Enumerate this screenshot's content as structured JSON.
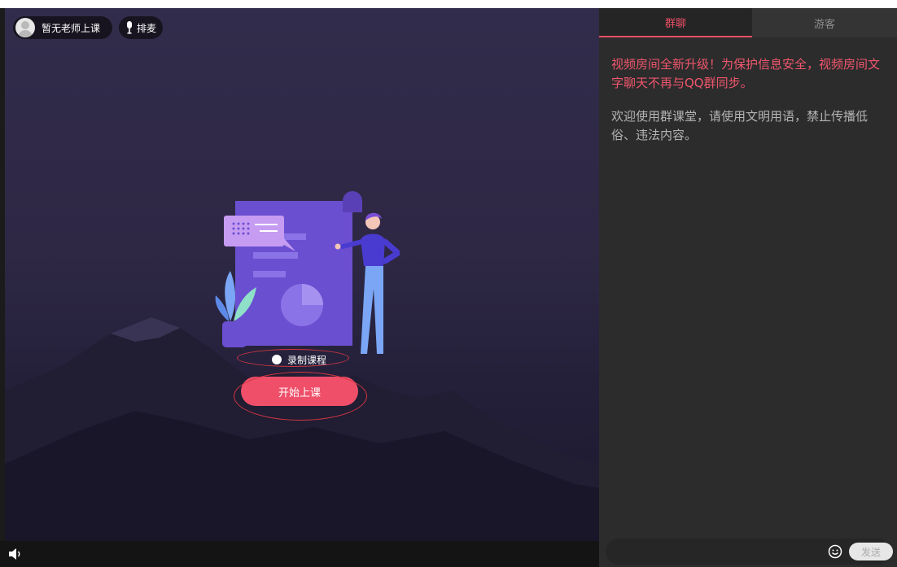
{
  "stage": {
    "teacher_label": "暂无老师上课",
    "queue_label": "排麦",
    "record_label": "录制课程",
    "start_button": "开始上课"
  },
  "chat_panel": {
    "tabs": [
      {
        "label": "群聊",
        "active": true
      },
      {
        "label": "游客",
        "active": false
      }
    ],
    "messages": [
      {
        "text": "视频房间全新升级！为保护信息安全，视频房间文字聊天不再与QQ群同步。",
        "color": "#f0566d"
      },
      {
        "text": "欢迎使用群课堂，请使用文明用语，禁止传播低俗、违法内容。",
        "color": "#b4b4b4"
      }
    ],
    "input_value": "",
    "send_label": "发送"
  },
  "icons": {
    "avatar": "user-avatar-icon",
    "mic": "microphone-icon",
    "volume": "speaker-icon",
    "emoji": "smiley-icon"
  },
  "colors": {
    "accent": "#ef4f69",
    "stage_bg": "#2e2845",
    "panel_bg": "#2c2c2c"
  }
}
